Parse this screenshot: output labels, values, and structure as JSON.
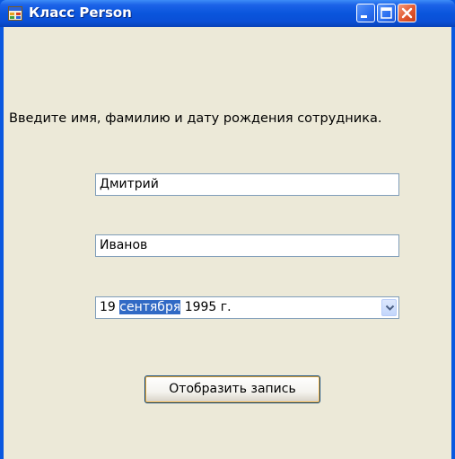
{
  "window": {
    "title": "Класс Person",
    "icon": "form-icon"
  },
  "controls": {
    "minimize_icon": "minimize-icon",
    "maximize_icon": "maximize-icon",
    "close_icon": "close-icon"
  },
  "form": {
    "prompt": "Введите имя, фамилию и дату рождения сотрудника.",
    "first_name": "Дмитрий",
    "last_name": "Иванов",
    "date": {
      "day": "19 ",
      "month": "сентября",
      "rest": " 1995 г."
    },
    "submit_label": "Отобразить запись"
  },
  "colors": {
    "titlebar": "#0a55dc",
    "client": "#ece9d8",
    "selection": "#316ac5",
    "close_button": "#e2582f"
  }
}
